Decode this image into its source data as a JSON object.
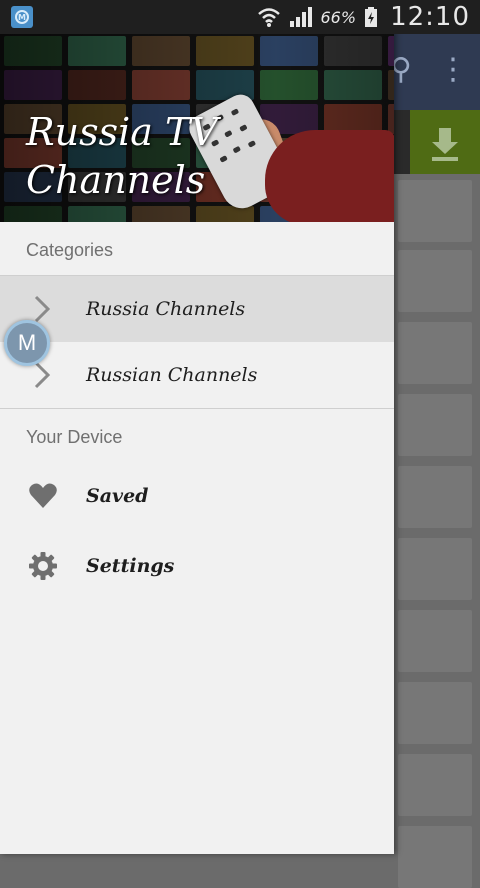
{
  "status_bar": {
    "battery_percent": "66%",
    "time": "12:10"
  },
  "drawer": {
    "title": "Russia TV Channels",
    "sections": {
      "categories_label": "Categories",
      "device_label": "Your Device"
    },
    "categories": [
      {
        "label": "Russia Channels",
        "active": true
      },
      {
        "label": "Russian Channels",
        "active": false
      }
    ],
    "device_items": [
      {
        "label": "Saved",
        "icon": "heart-icon"
      },
      {
        "label": "Settings",
        "icon": "gear-icon"
      }
    ]
  },
  "floating_button": {
    "label": "M"
  },
  "colors": {
    "drawer_bg": "#f1f1f1",
    "active_item": "#dcdcdc",
    "toolbar": "#2f3a52",
    "download_button": "#4f6b14"
  }
}
